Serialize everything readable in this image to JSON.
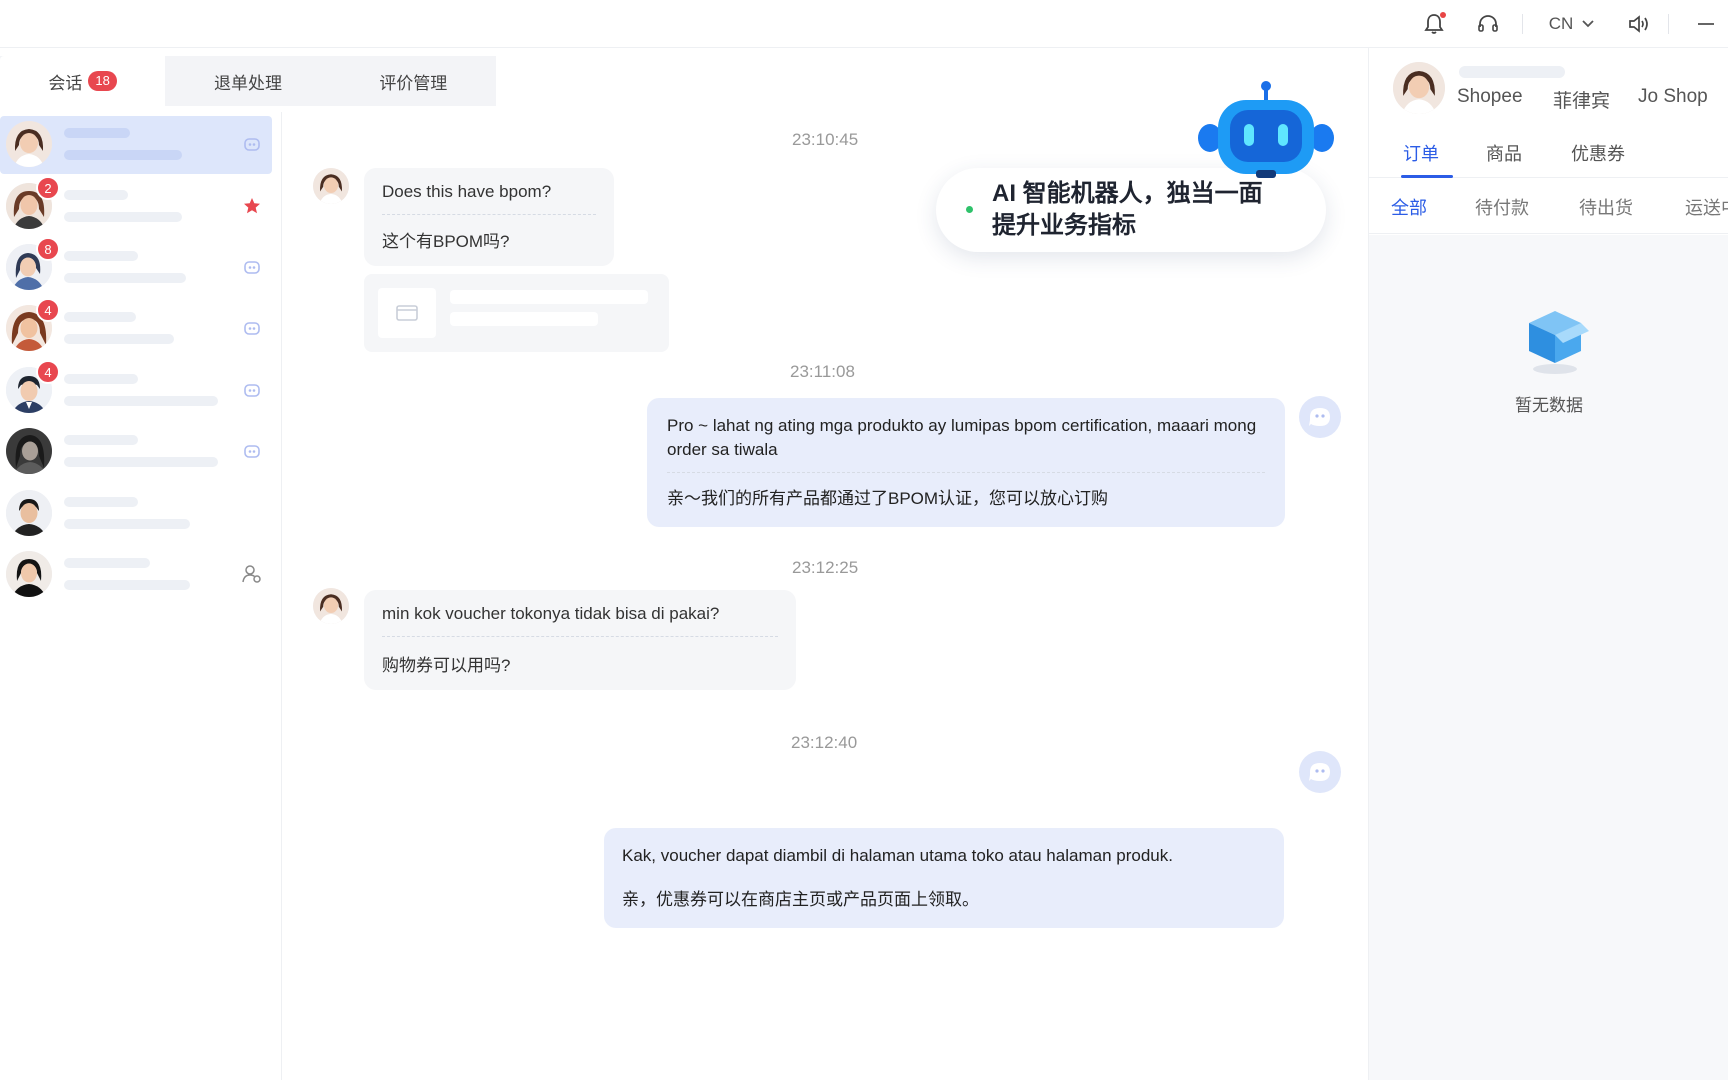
{
  "topbar": {
    "language": "CN"
  },
  "tabs": [
    {
      "label": "会话",
      "badge": "18"
    },
    {
      "label": "退单处理"
    },
    {
      "label": "评价管理"
    }
  ],
  "conversations": [
    {
      "unread": ""
    },
    {
      "unread": "2"
    },
    {
      "unread": "8"
    },
    {
      "unread": "4"
    },
    {
      "unread": "4"
    },
    {
      "unread": ""
    },
    {
      "unread": ""
    },
    {
      "unread": ""
    }
  ],
  "chat": {
    "messages": [
      {
        "time": "23:10:45",
        "original": "Does this have bpom?",
        "translation": "这个有BPOM吗?"
      },
      {
        "time": "23:11:08",
        "original": "Pro ~ lahat ng ating mga produkto ay lumipas bpom certification, maaari mong order sa tiwala",
        "translation": "亲～我们的所有产品都通过了BPOM认证，您可以放心订购"
      },
      {
        "time": "23:12:25",
        "original": "min kok voucher tokonya tidak bisa di pakai?",
        "translation": "购物券可以用吗?"
      },
      {
        "time": "23:12:40",
        "original": "Kak, voucher dapat diambil di halaman utama toko atau halaman produk.",
        "translation": "亲，优惠券可以在商店主页或产品页面上领取。"
      }
    ]
  },
  "ai_banner": {
    "line1": "AI 智能机器人，独当一面",
    "line2": "提升业务指标"
  },
  "right_panel": {
    "platform": "Shopee",
    "country": "菲律宾",
    "shop": "Jo Shop",
    "tabs": [
      "订单",
      "商品",
      "优惠券"
    ],
    "subtabs": [
      "全部",
      "待付款",
      "待出货",
      "运送中"
    ],
    "empty_text": "暂无数据"
  },
  "colors": {
    "accent": "#2b5ce6",
    "badge": "#e8474f",
    "bubble_out": "#e8edfb",
    "bubble_in": "#f5f6f8"
  }
}
